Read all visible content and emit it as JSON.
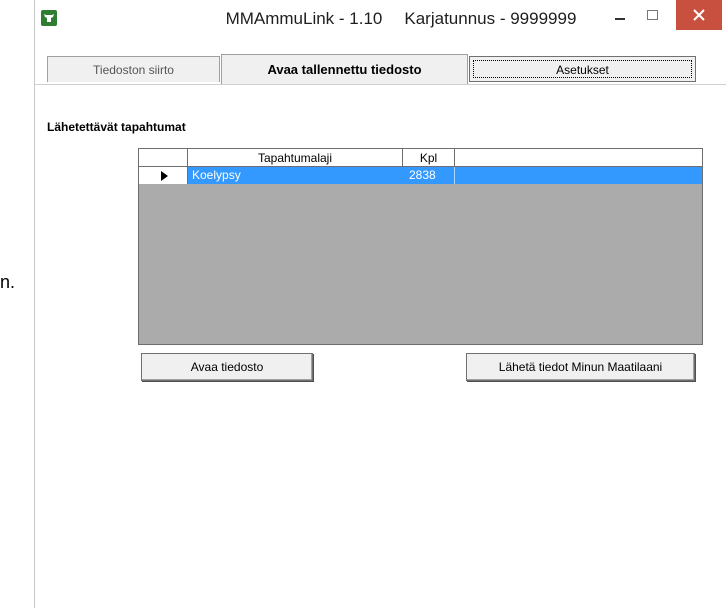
{
  "stray_text": "n.",
  "window": {
    "app_name": "MMAmmuLink - 1.10",
    "farm_id": "Karjatunnus - 9999999"
  },
  "tabs": [
    {
      "label": "Tiedoston siirto"
    },
    {
      "label": "Avaa tallennettu tiedosto"
    },
    {
      "label": "Asetukset"
    }
  ],
  "section": {
    "heading": "Lähetettävät tapahtumat"
  },
  "grid": {
    "columns": [
      "Tapahtumalaji",
      "Kpl"
    ],
    "rows": [
      {
        "tapahtumalaji": "Koelypsy",
        "kpl": "2838"
      }
    ]
  },
  "buttons": {
    "open": "Avaa tiedosto",
    "send": "Lähetä tiedot Minun Maatilaani"
  },
  "colors": {
    "selection": "#3399ff",
    "close_button": "#c7503e",
    "app_icon": "#2f7d32"
  }
}
